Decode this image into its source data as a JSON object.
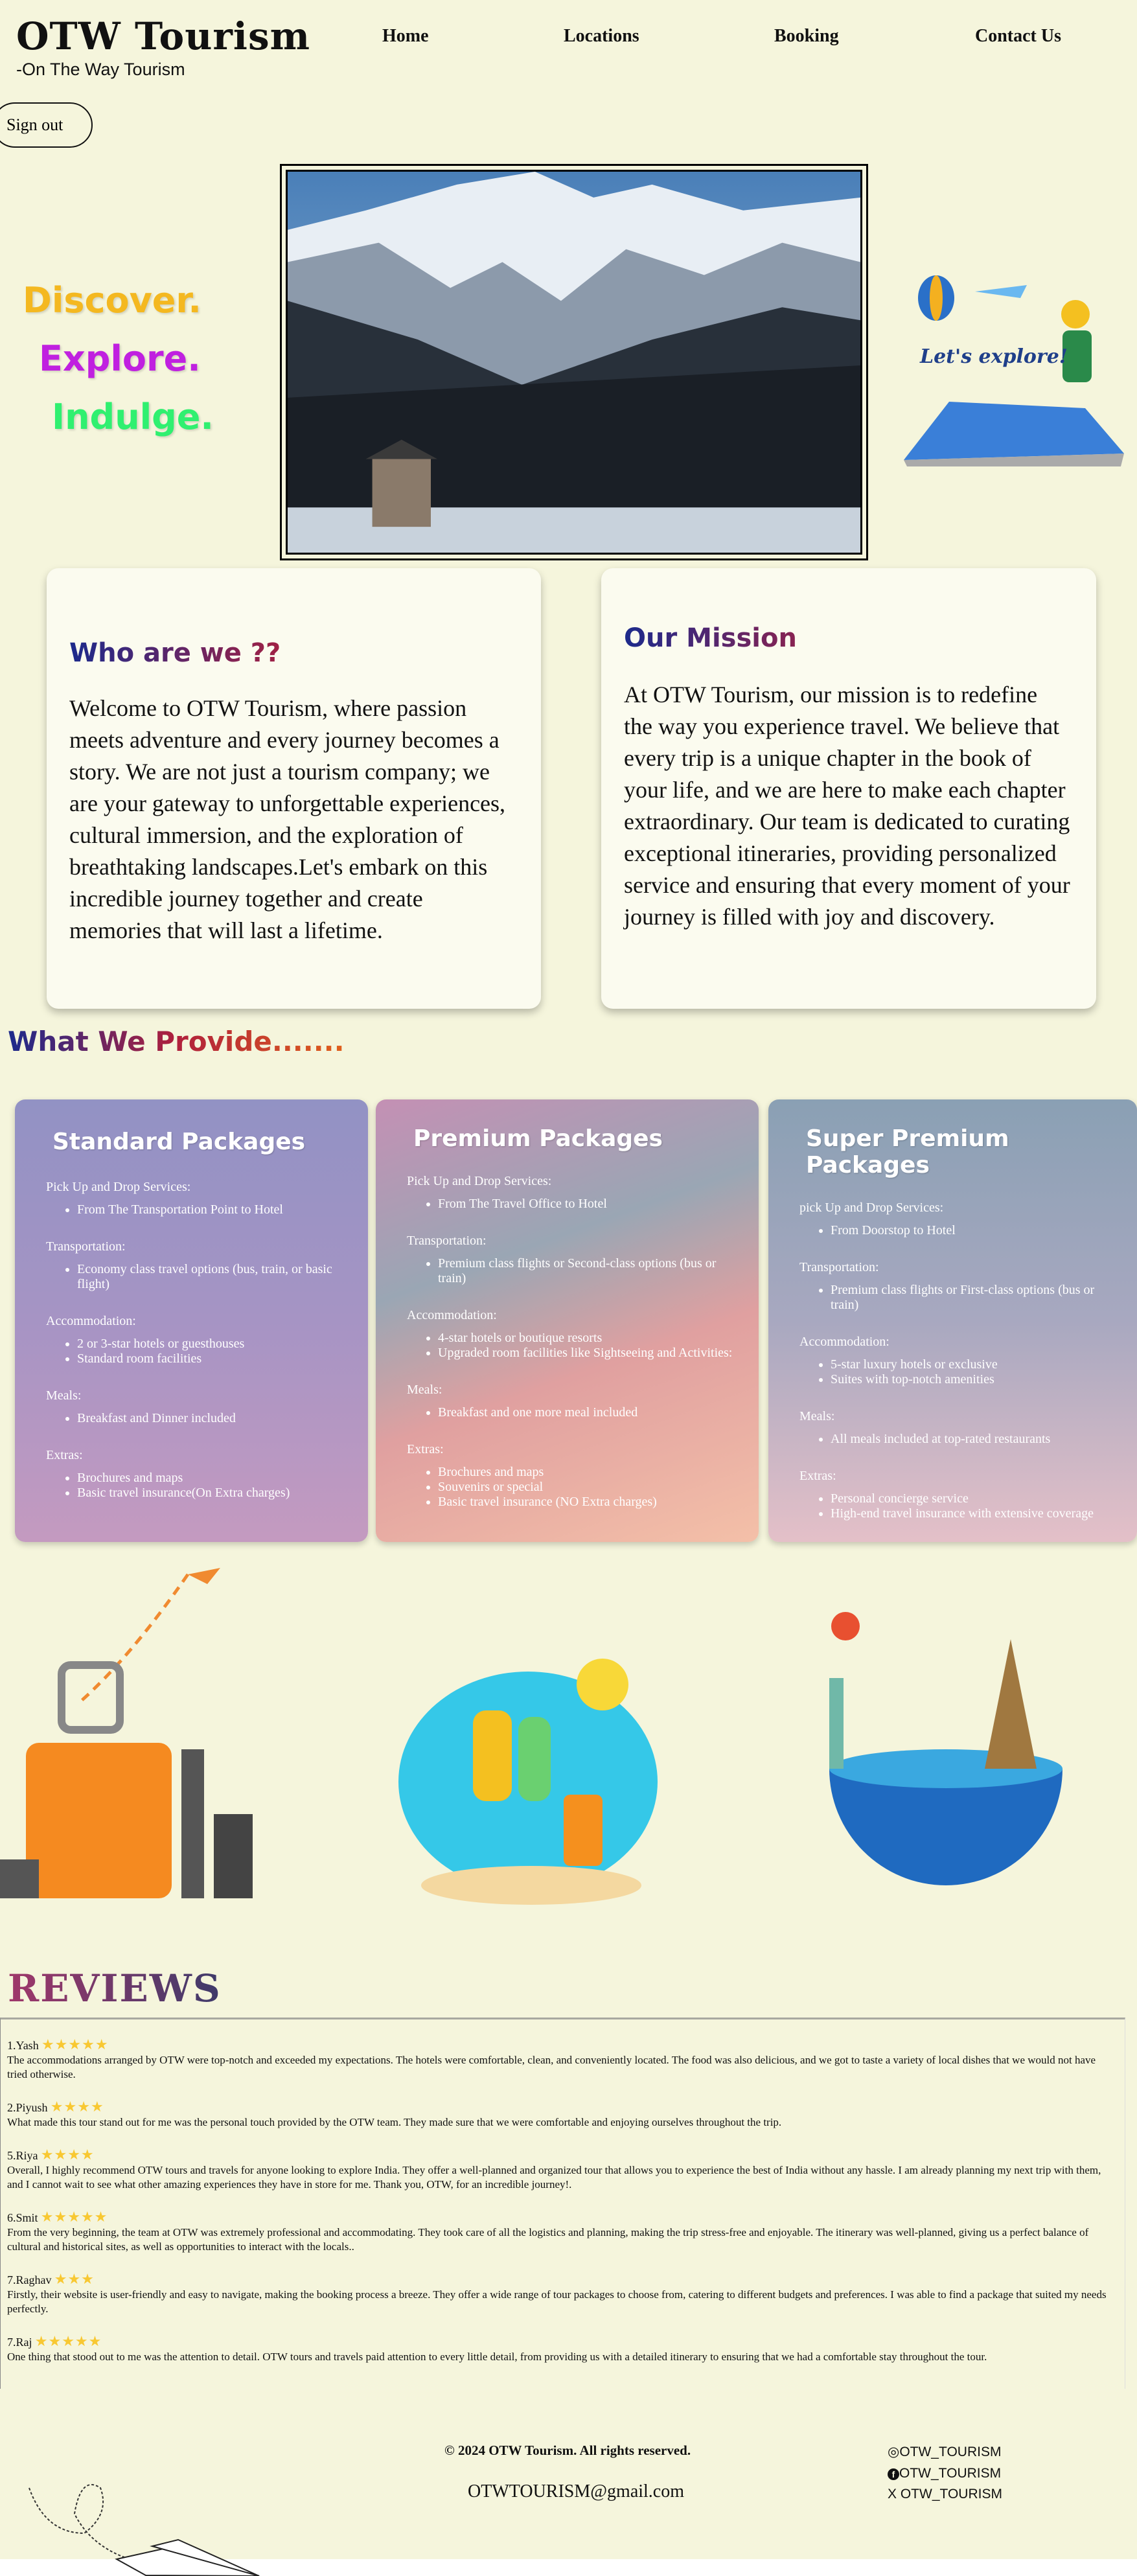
{
  "header": {
    "logo": "OTW Tourism",
    "tagline": "-On The Way Tourism",
    "nav": [
      "Home",
      "Locations",
      "Booking",
      "Contact Us"
    ],
    "sign_out": "Sign out"
  },
  "hero": {
    "taglines": [
      "Discover.",
      "Explore.",
      "Indulge."
    ],
    "colors": [
      "#f4b820",
      "#c020e0",
      "#30f070"
    ],
    "illustration_text": "Let's explore!"
  },
  "about": {
    "title": "Who are we ??",
    "text": "Welcome to OTW Tourism, where passion meets adventure and every journey becomes a story. We are not just a tourism company; we are your gateway to unforgettable experiences, cultural immersion, and the exploration of breathtaking landscapes.Let's embark on this incredible journey together and create memories that will last a lifetime."
  },
  "mission": {
    "title": "Our Mission",
    "text": "At OTW Tourism, our mission is to redefine the way you experience travel. We believe that every trip is a unique chapter in the book of your life, and we are here to make each chapter extraordinary. Our team is dedicated to curating exceptional itineraries, providing personalized service and ensuring that every moment of your journey is filled with joy and discovery."
  },
  "provide_title": "What We Provide.......",
  "packages": [
    {
      "title": "Standard Packages",
      "sections": [
        {
          "label": "Pick Up and Drop Services:",
          "items": [
            "From The Transportation Point to Hotel"
          ]
        },
        {
          "label": "Transportation:",
          "items": [
            "Economy class travel options (bus, train, or basic flight)"
          ]
        },
        {
          "label": "Accommodation:",
          "items": [
            "2 or 3-star hotels or guesthouses",
            "Standard room facilities"
          ]
        },
        {
          "label": "Meals:",
          "items": [
            "Breakfast and Dinner included"
          ]
        },
        {
          "label": "Extras:",
          "items": [
            "Brochures and maps",
            "Basic travel insurance(On Extra charges)"
          ]
        }
      ]
    },
    {
      "title": "Premium Packages",
      "sections": [
        {
          "label": "Pick Up and Drop Services:",
          "items": [
            "From The Travel Office to Hotel"
          ]
        },
        {
          "label": "Transportation:",
          "items": [
            "Premium class flights or Second-class options (bus or train)"
          ]
        },
        {
          "label": "Accommodation:",
          "items": [
            "4-star hotels or boutique resorts",
            "Upgraded room facilities like Sightseeing and Activities:"
          ]
        },
        {
          "label": "Meals:",
          "items": [
            "Breakfast and one more meal included"
          ]
        },
        {
          "label": "Extras:",
          "items": [
            "Brochures and maps",
            "Souvenirs or special",
            "Basic travel insurance (NO Extra charges)"
          ]
        }
      ]
    },
    {
      "title": "Super Premium Packages",
      "sections": [
        {
          "label": "pick Up and Drop Services:",
          "items": [
            "From Doorstop to Hotel"
          ]
        },
        {
          "label": "Transportation:",
          "items": [
            "Premium class flights or First-class options (bus or train)"
          ]
        },
        {
          "label": "Accommodation:",
          "items": [
            "5-star luxury hotels or exclusive",
            "Suites with top-notch amenities"
          ]
        },
        {
          "label": "Meals:",
          "items": [
            "All meals included at top-rated restaurants"
          ]
        },
        {
          "label": "Extras:",
          "items": [
            "Personal concierge service",
            "High-end travel insurance with extensive coverage"
          ]
        }
      ]
    }
  ],
  "reviews_title": "REVIEWS",
  "reviews": [
    {
      "name": "1.Yash",
      "stars": 5,
      "text": "The accommodations arranged by OTW were top-notch and exceeded my expectations. The hotels were comfortable, clean, and conveniently located. The food was also delicious, and we got to taste a variety of local dishes that we would not have tried otherwise."
    },
    {
      "name": "2.Piyush",
      "stars": 4,
      "text": "What made this tour stand out for me was the personal touch provided by the OTW team. They made sure that we were comfortable and enjoying ourselves throughout the trip."
    },
    {
      "name": "5.Riya",
      "stars": 4,
      "text": "Overall, I highly recommend OTW tours and travels for anyone looking to explore India. They offer a well-planned and organized tour that allows you to experience the best of India without any hassle. I am already planning my next trip with them, and I cannot wait to see what other amazing experiences they have in store for me. Thank you, OTW, for an incredible journey!."
    },
    {
      "name": "6.Smit",
      "stars": 5,
      "text": "From the very beginning, the team at OTW was extremely professional and accommodating. They took care of all the logistics and planning, making the trip stress-free and enjoyable. The itinerary was well-planned, giving us a perfect balance of cultural and historical sites, as well as opportunities to interact with the locals.."
    },
    {
      "name": "7.Raghav",
      "stars": 3,
      "text": "Firstly, their website is user-friendly and easy to navigate, making the booking process a breeze. They offer a wide range of tour packages to choose from, catering to different budgets and preferences. I was able to find a package that suited my needs perfectly."
    },
    {
      "name": "7.Raj",
      "stars": 5,
      "text": "One thing that stood out to me was the attention to detail. OTW tours and travels paid attention to every little detail, from providing us with a detailed itinerary to ensuring that we had a comfortable stay throughout the tour."
    }
  ],
  "footer": {
    "copyright": "© 2024 OTW Tourism. All rights reserved.",
    "email": "OTWTOURISM@gmail.com",
    "socials": [
      {
        "icon": "instagram-icon",
        "handle": "OTW_TOURISM"
      },
      {
        "icon": "facebook-icon",
        "handle": "OTW_TOURISM"
      },
      {
        "icon": "x-icon",
        "handle": "OTW_TOURISM"
      }
    ]
  }
}
